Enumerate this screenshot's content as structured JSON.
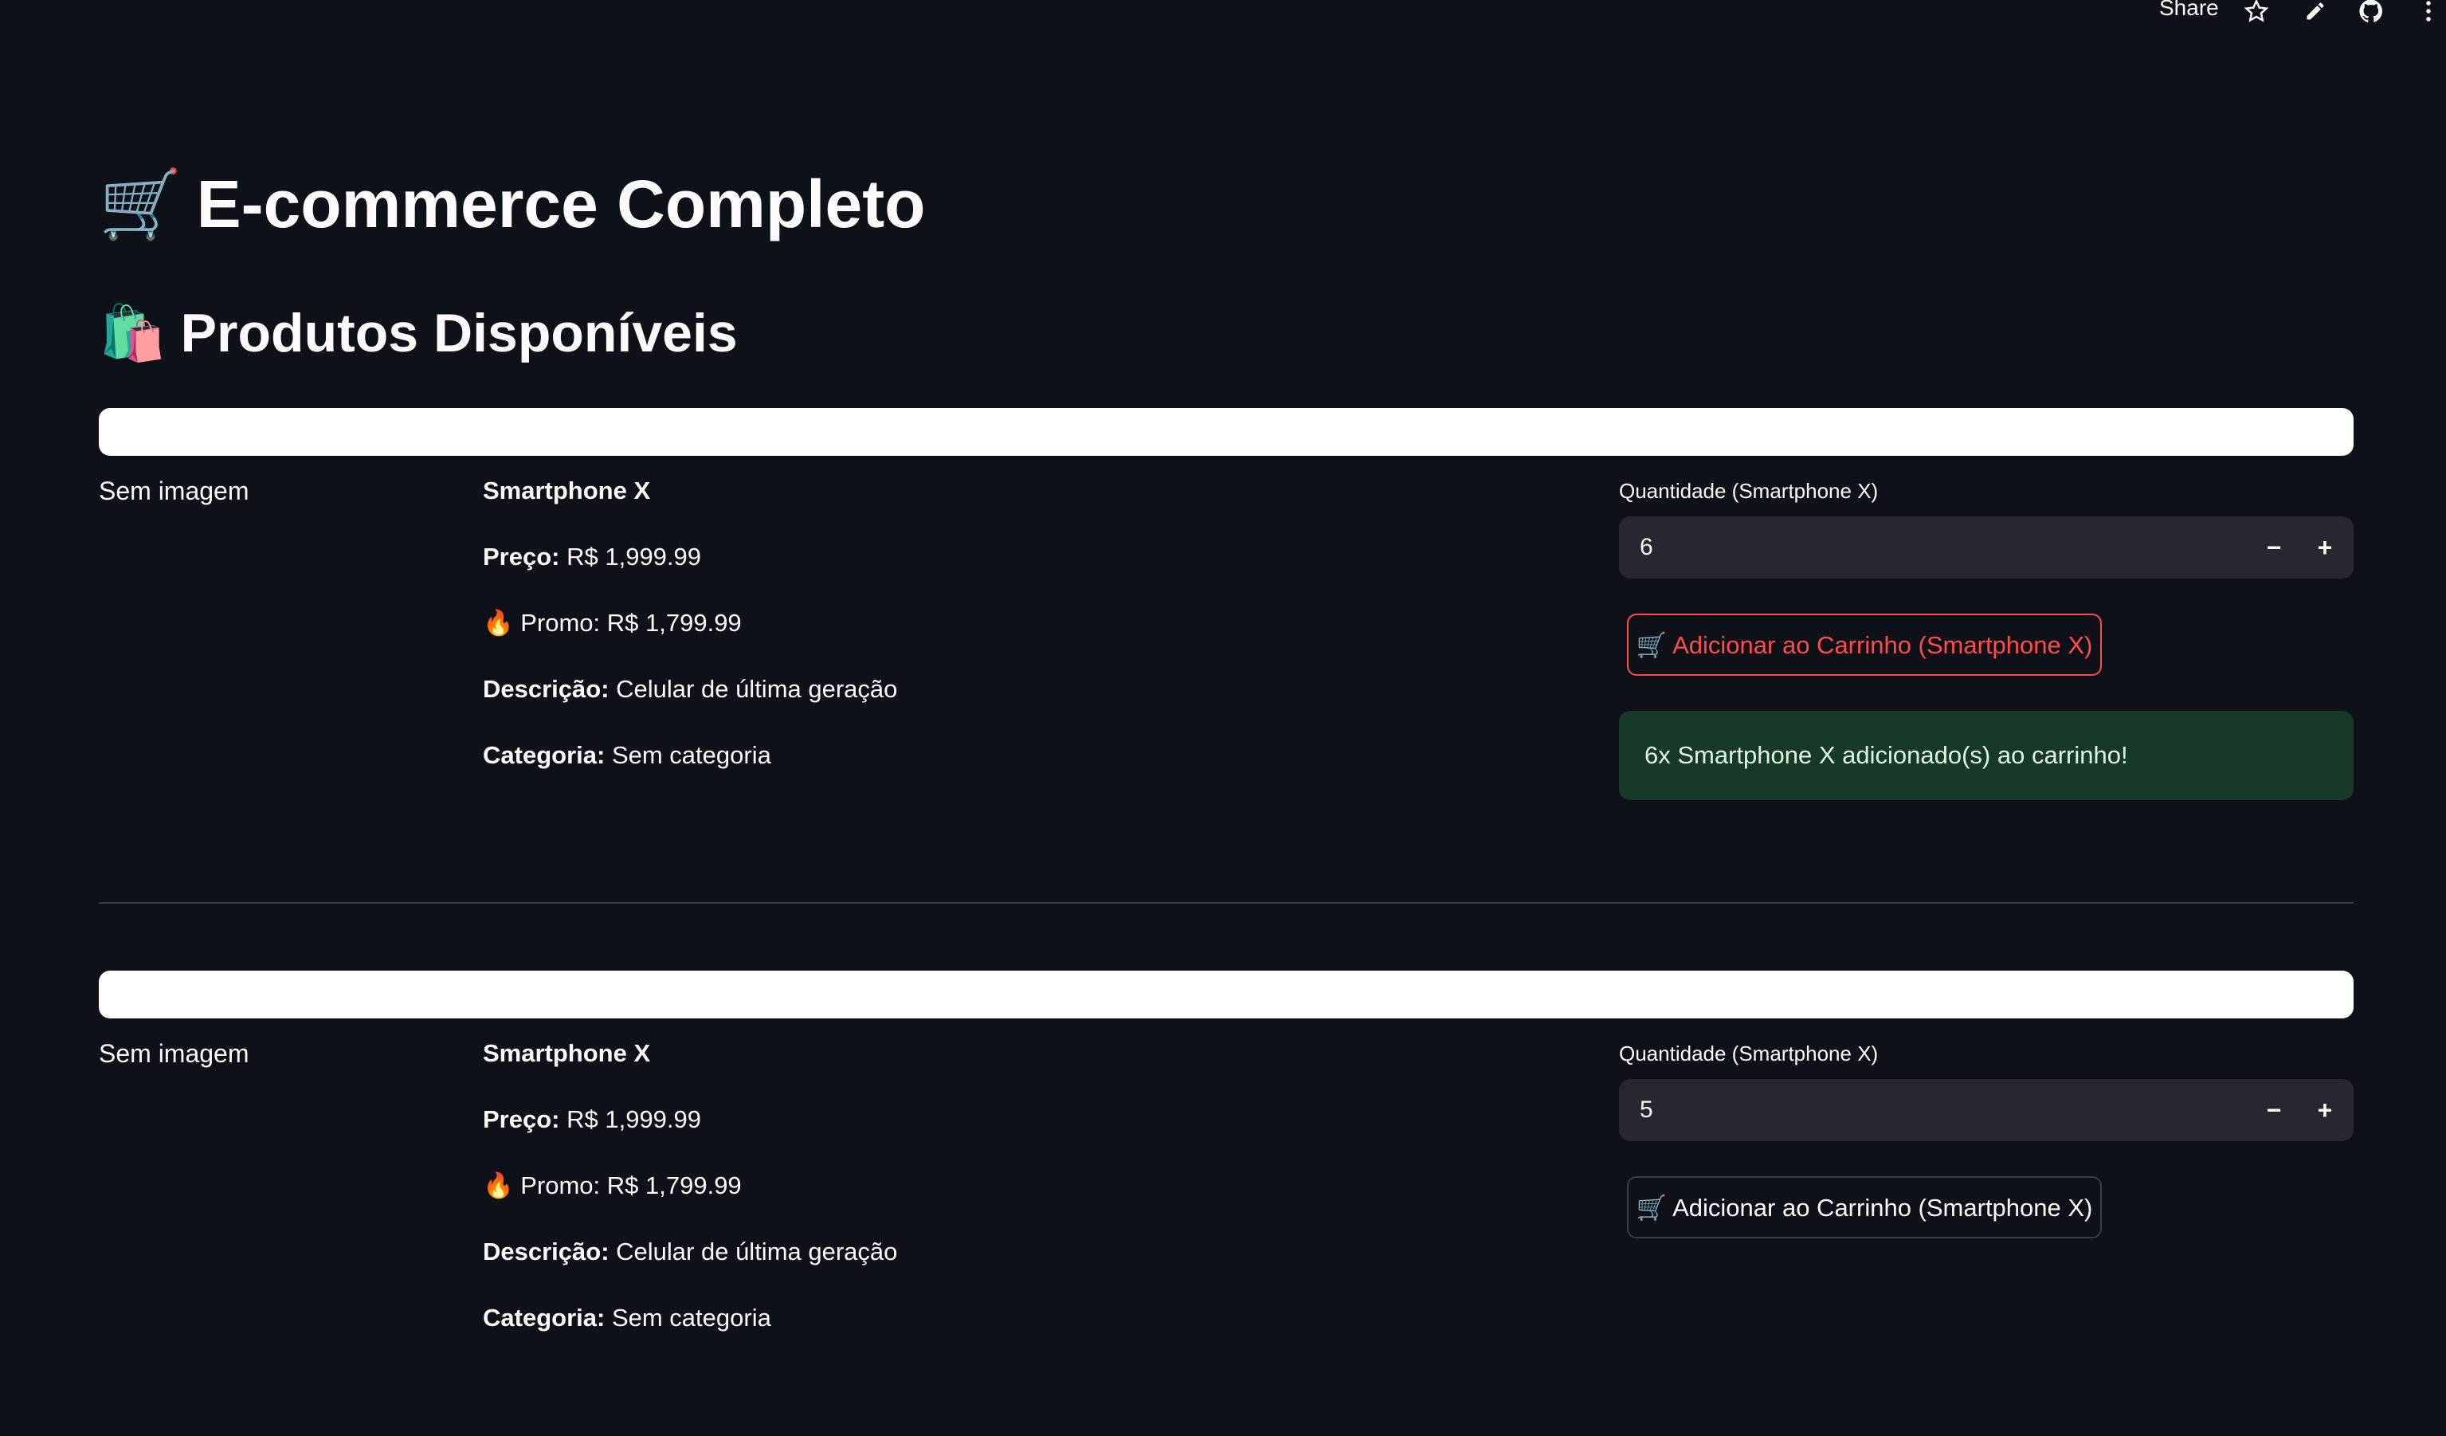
{
  "toolbar": {
    "share_label": "Share",
    "icons": [
      "star-icon",
      "pencil-icon",
      "github-icon",
      "kebab-menu-icon"
    ]
  },
  "page": {
    "title_emoji": "🛒",
    "title": "E-commerce Completo",
    "subtitle_emoji": "🛍️",
    "subtitle": "Produtos Disponíveis"
  },
  "products": [
    {
      "image_placeholder": "Sem imagem",
      "name": "Smartphone X",
      "price_label": "Preço:",
      "price_value": "R$ 1,999.99",
      "promo_emoji": "🔥",
      "promo_text": "Promo: R$ 1,799.99",
      "description_label": "Descrição:",
      "description_value": "Celular de última geração",
      "category_label": "Categoria:",
      "category_value": "Sem categoria",
      "quantity_label": "Quantidade (Smartphone X)",
      "quantity_value": "6",
      "add_button_label": "🛒 Adicionar ao Carrinho (Smartphone X)",
      "success_message": "6x Smartphone X adicionado(s) ao carrinho!"
    },
    {
      "image_placeholder": "Sem imagem",
      "name": "Smartphone X",
      "price_label": "Preço:",
      "price_value": "R$ 1,999.99",
      "promo_emoji": "🔥",
      "promo_text": "Promo: R$ 1,799.99",
      "description_label": "Descrição:",
      "description_value": "Celular de última geração",
      "category_label": "Categoria:",
      "category_value": "Sem categoria",
      "quantity_label": "Quantidade (Smartphone X)",
      "quantity_value": "5",
      "add_button_label": "🛒 Adicionar ao Carrinho (Smartphone X)"
    }
  ],
  "colors": {
    "background": "#0e1117",
    "accent": "#ff4b4b",
    "success_bg": "#173928",
    "input_bg": "#262730"
  }
}
